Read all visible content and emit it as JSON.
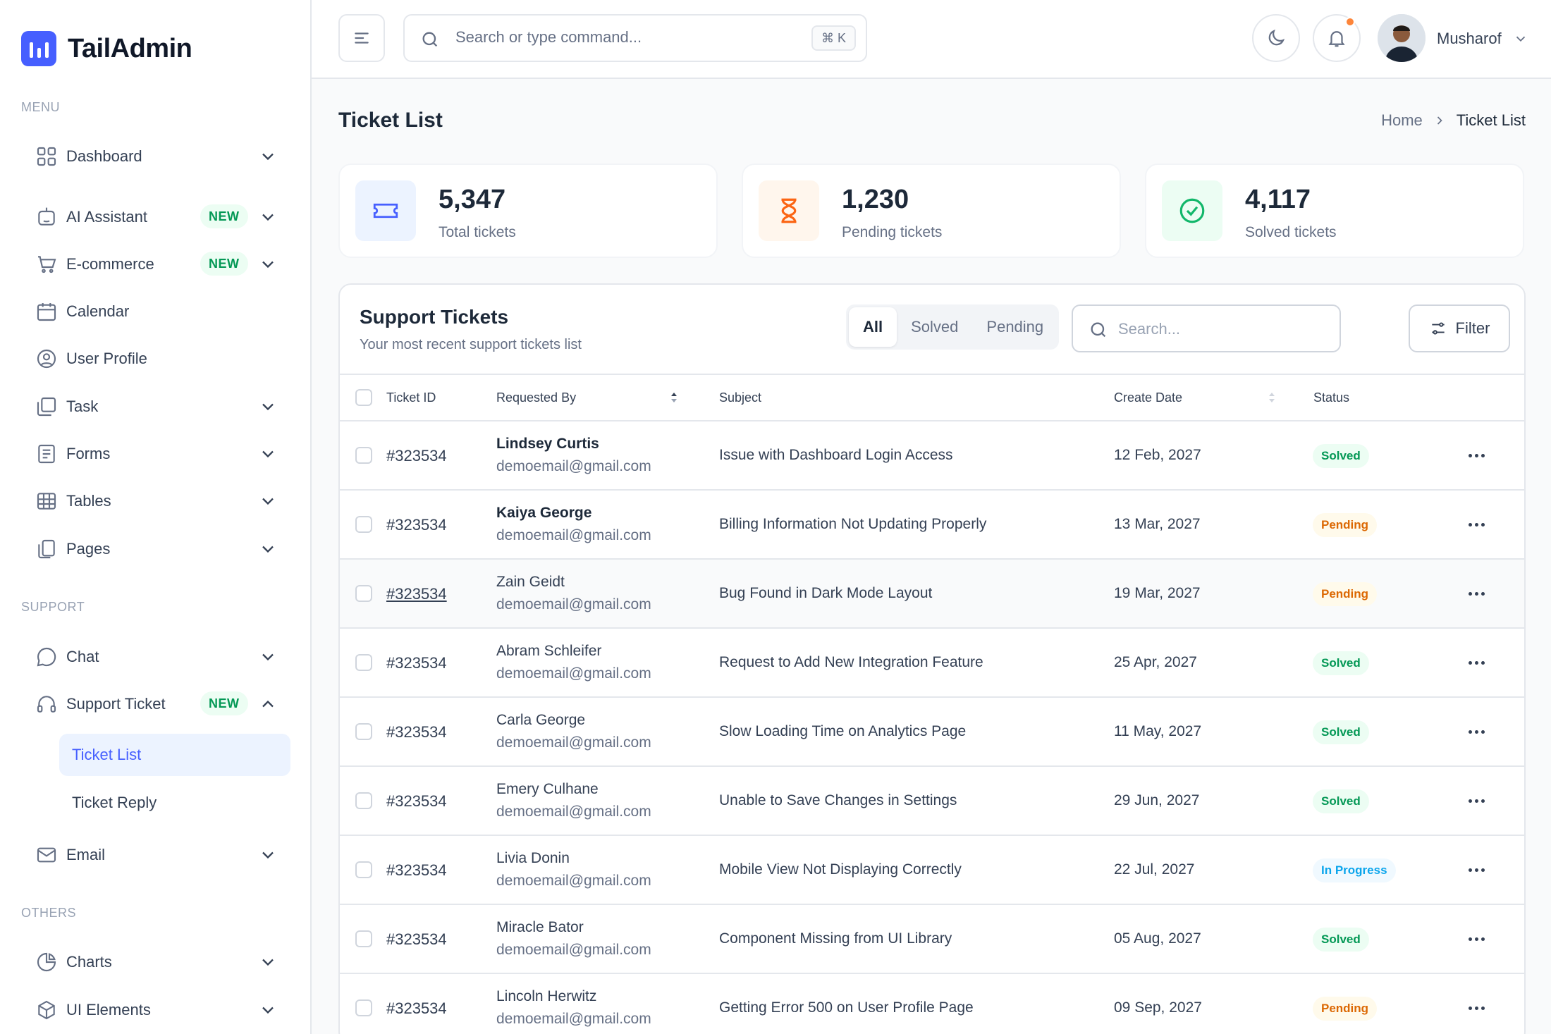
{
  "app": {
    "name": "TailAdmin"
  },
  "sidebar": {
    "menu_title": "MENU",
    "support_title": "SUPPORT",
    "others_title": "OTHERS",
    "menu_items": [
      {
        "label": "Dashboard",
        "icon": "grid-icon"
      },
      {
        "label": "AI Assistant",
        "icon": "robot-icon",
        "badge": "NEW"
      },
      {
        "label": "E-commerce",
        "icon": "cart-icon",
        "badge": "NEW"
      },
      {
        "label": "Calendar",
        "icon": "calendar-icon"
      },
      {
        "label": "User Profile",
        "icon": "user-circle-icon"
      },
      {
        "label": "Task",
        "icon": "task-icon"
      },
      {
        "label": "Forms",
        "icon": "forms-icon"
      },
      {
        "label": "Tables",
        "icon": "table-icon"
      },
      {
        "label": "Pages",
        "icon": "pages-icon"
      }
    ],
    "support_items": [
      {
        "label": "Chat",
        "icon": "chat-icon"
      },
      {
        "label": "Support Ticket",
        "icon": "headphones-icon",
        "badge": "NEW"
      },
      {
        "label": "Email",
        "icon": "mail-icon"
      }
    ],
    "support_sub_items": [
      {
        "label": "Ticket List",
        "active": true
      },
      {
        "label": "Ticket Reply"
      }
    ],
    "others_items": [
      {
        "label": "Charts",
        "icon": "pie-chart-icon"
      },
      {
        "label": "UI Elements",
        "icon": "box-icon"
      }
    ]
  },
  "header": {
    "search_placeholder": "Search or type command...",
    "shortcut": "⌘ K",
    "user_name": "Musharof"
  },
  "page": {
    "title": "Ticket List",
    "breadcrumb": {
      "home": "Home",
      "current": "Ticket List"
    }
  },
  "stats": [
    {
      "value": "5,347",
      "label": "Total tickets",
      "icon": "ticket-icon",
      "bg": "#ecf3ff",
      "color": "#465fff"
    },
    {
      "value": "1,230",
      "label": "Pending tickets",
      "icon": "hourglass-icon",
      "bg": "#fff6ed",
      "color": "#fb6514"
    },
    {
      "value": "4,117",
      "label": "Solved tickets",
      "icon": "check-circle-icon",
      "bg": "#ecfdf3",
      "color": "#12b76a"
    }
  ],
  "tickets_panel": {
    "title": "Support Tickets",
    "subtitle": "Your most recent support tickets list",
    "tabs": [
      "All",
      "Solved",
      "Pending"
    ],
    "active_tab": "All",
    "search_placeholder": "Search...",
    "filter_label": "Filter",
    "columns": [
      "Ticket ID",
      "Requested By",
      "Subject",
      "Create Date",
      "Status"
    ],
    "rows": [
      {
        "id": "#323534",
        "name": "Lindsey Curtis",
        "email": "demoemail@gmail.com",
        "subject": "Issue with Dashboard Login Access",
        "date": "12 Feb, 2027",
        "status": "Solved"
      },
      {
        "id": "#323534",
        "name": "Kaiya George",
        "email": "demoemail@gmail.com",
        "subject": "Billing Information Not Updating Properly",
        "date": "13 Mar, 2027",
        "status": "Pending"
      },
      {
        "id": "#323534",
        "name": "Zain Geidt",
        "email": "demoemail@gmail.com",
        "subject": "Bug Found in Dark Mode Layout",
        "date": "19 Mar, 2027",
        "status": "Pending"
      },
      {
        "id": "#323534",
        "name": "Abram Schleifer",
        "email": "demoemail@gmail.com",
        "subject": "Request to Add New Integration Feature",
        "date": "25 Apr, 2027",
        "status": "Solved"
      },
      {
        "id": "#323534",
        "name": "Carla George",
        "email": "demoemail@gmail.com",
        "subject": "Slow Loading Time on Analytics Page",
        "date": "11 May, 2027",
        "status": "Solved"
      },
      {
        "id": "#323534",
        "name": "Emery Culhane",
        "email": "demoemail@gmail.com",
        "subject": "Unable to Save Changes in Settings",
        "date": "29 Jun, 2027",
        "status": "Solved"
      },
      {
        "id": "#323534",
        "name": "Livia Donin",
        "email": "demoemail@gmail.com",
        "subject": "Mobile View Not Displaying Correctly",
        "date": "22 Jul, 2027",
        "status": "In Progress"
      },
      {
        "id": "#323534",
        "name": "Miracle Bator",
        "email": "demoemail@gmail.com",
        "subject": "Component Missing from UI Library",
        "date": "05 Aug, 2027",
        "status": "Solved"
      },
      {
        "id": "#323534",
        "name": "Lincoln Herwitz",
        "email": "demoemail@gmail.com",
        "subject": "Getting Error 500 on User Profile Page",
        "date": "09 Sep, 2027",
        "status": "Pending"
      }
    ]
  },
  "colors": {
    "brand": "#465fff",
    "solved": "#039855",
    "pending": "#dc6803",
    "in_progress": "#0ba5ec"
  }
}
